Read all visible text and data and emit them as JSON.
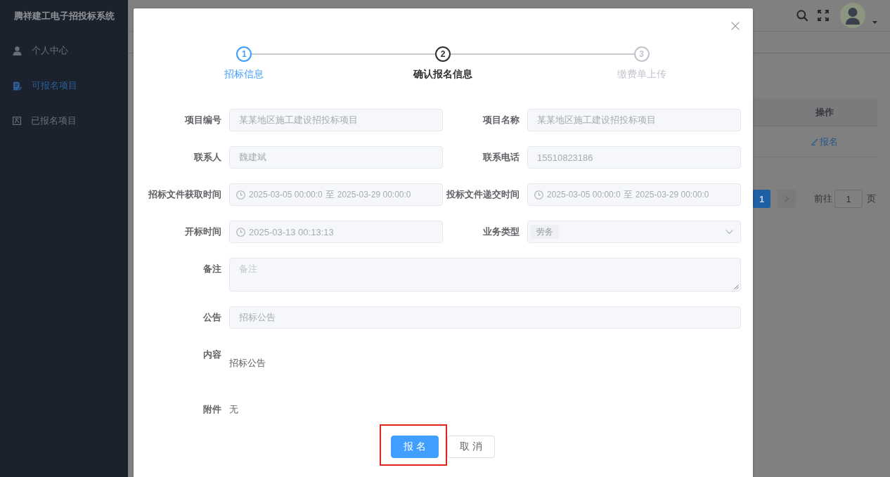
{
  "sidebar": {
    "title": "腾祥建工电子招投标系统",
    "items": [
      {
        "label": "个人中心",
        "selected": false
      },
      {
        "label": "可报名项目",
        "selected": true
      },
      {
        "label": "已报名项目",
        "selected": false
      }
    ]
  },
  "table": {
    "columns": [
      "操作"
    ],
    "rows": [
      {
        "action": "报名"
      }
    ]
  },
  "pagination": {
    "pages": [
      {
        "label": "1",
        "selected": true
      }
    ],
    "next_disabled": true,
    "goto_label": "前往",
    "goto_value": "1",
    "page_suffix": "页"
  },
  "dialog": {
    "steps": [
      {
        "number": "1",
        "label": "招标信息",
        "completed": true,
        "selected": false
      },
      {
        "number": "2",
        "label": "确认报名信息",
        "completed": false,
        "selected": true
      },
      {
        "number": "3",
        "label": "缴费单上传",
        "completed": false,
        "selected": false
      }
    ],
    "rows": [
      {
        "fields": [
          {
            "kind": "input",
            "label": "项目编号",
            "value": "某某地区施工建设招投标项目",
            "disabled": true
          },
          {
            "kind": "input",
            "label": "项目名称",
            "value": "某某地区施工建设招投标项目",
            "disabled": true
          }
        ]
      },
      {
        "fields": [
          {
            "kind": "input",
            "label": "联系人",
            "value": "魏建斌",
            "disabled": true
          },
          {
            "kind": "input",
            "label": "联系电话",
            "value": "15510823186",
            "disabled": true
          }
        ]
      },
      {
        "fields": [
          {
            "kind": "date-range",
            "label": "招标文件获取时间",
            "start": "2025-03-05 00:00:0",
            "separator": "至",
            "end": "2025-03-29 00:00:0",
            "disabled": true
          },
          {
            "kind": "date-range",
            "label": "投标文件递交时间",
            "start": "2025-03-05 00:00:0",
            "separator": "至",
            "end": "2025-03-29 00:00:0",
            "disabled": true
          }
        ]
      },
      {
        "fields": [
          {
            "kind": "date",
            "label": "开标时间",
            "value": "2025-03-13 00:13:13",
            "disabled": true
          },
          {
            "kind": "select",
            "label": "业务类型",
            "tags": [
              "劳务"
            ],
            "disabled": true
          }
        ]
      },
      {
        "fields": [
          {
            "kind": "textarea",
            "label": "备注",
            "placeholder": "备注",
            "disabled": true
          }
        ]
      },
      {
        "fields": [
          {
            "kind": "input",
            "label": "公告",
            "value": "招标公告",
            "disabled": true
          }
        ]
      },
      {
        "fields": [
          {
            "kind": "content",
            "label": "内容",
            "value": "招标公告"
          }
        ]
      },
      {
        "fields": [
          {
            "kind": "text",
            "label": "附件",
            "value": "无"
          }
        ]
      }
    ],
    "buttons": [
      {
        "label": "报 名",
        "kind": "primary",
        "highlighted": true
      },
      {
        "label": "取 消",
        "kind": "default",
        "highlighted": false
      }
    ]
  }
}
